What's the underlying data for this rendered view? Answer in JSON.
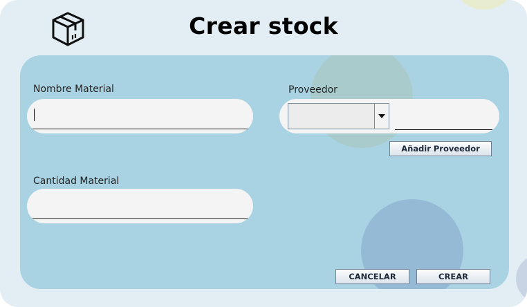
{
  "header": {
    "title": "Crear stock",
    "icon": "package-box-icon"
  },
  "form": {
    "nombre_material": {
      "label": "Nombre Material",
      "value": ""
    },
    "cantidad_material": {
      "label": "Cantidad Material",
      "value": ""
    },
    "proveedor": {
      "label": "Proveedor",
      "selected": "",
      "value": ""
    }
  },
  "buttons": {
    "add_provider": "Añadir Proveedor",
    "cancel": "CANCELAR",
    "create": "CREAR"
  },
  "colors": {
    "window_bg": "#e2eef4",
    "panel_bg": "#a9d3e2",
    "field_bg": "#f4f4f4"
  }
}
